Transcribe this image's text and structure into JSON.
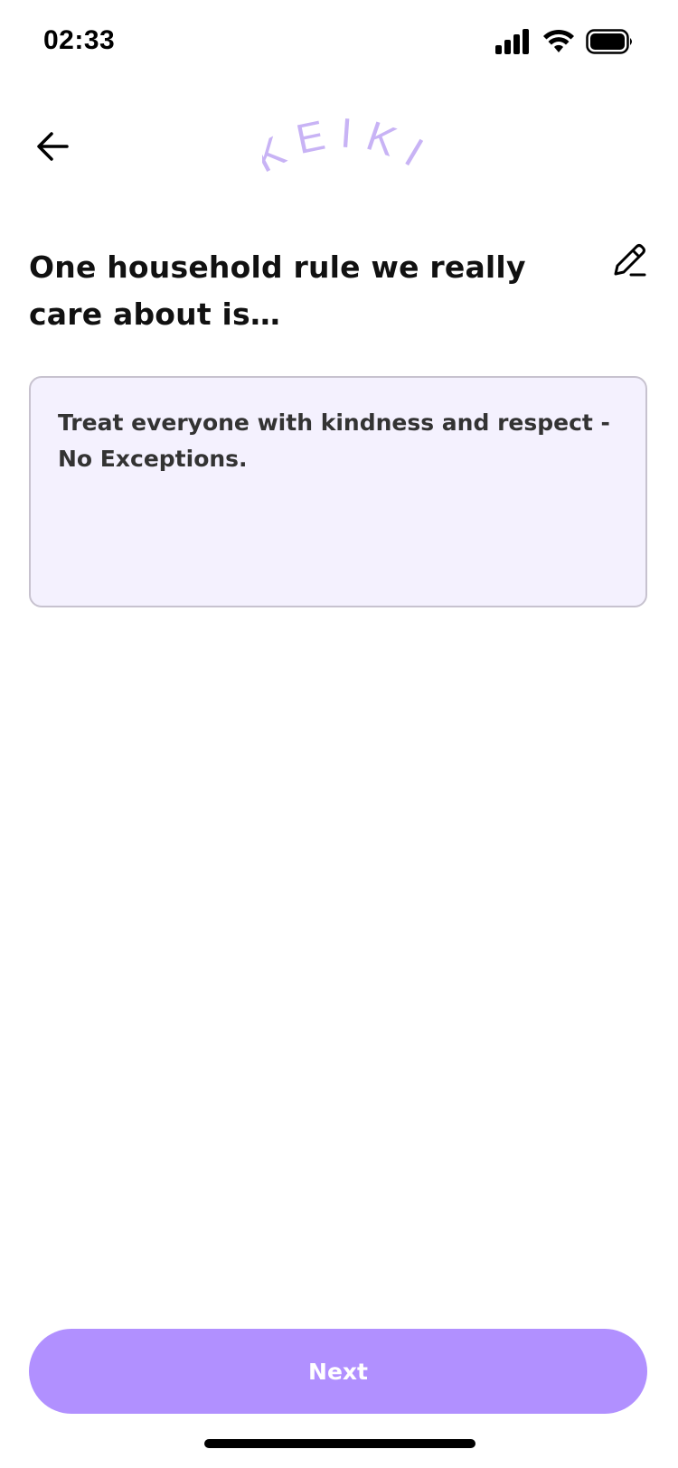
{
  "status_bar": {
    "time": "02:33",
    "icons": [
      "cellular-signal-icon",
      "wifi-icon",
      "battery-icon"
    ]
  },
  "header": {
    "back_icon": "arrow-left-icon",
    "logo_text": "KEIKI",
    "logo_color": "#c8b3f5"
  },
  "question": {
    "text": "One household rule we really care about is…",
    "edit_icon": "pencil-icon"
  },
  "answer": {
    "value": "Treat everyone with kindness and respect - No Exceptions."
  },
  "footer": {
    "next_label": "Next",
    "button_color": "#b190ff"
  }
}
